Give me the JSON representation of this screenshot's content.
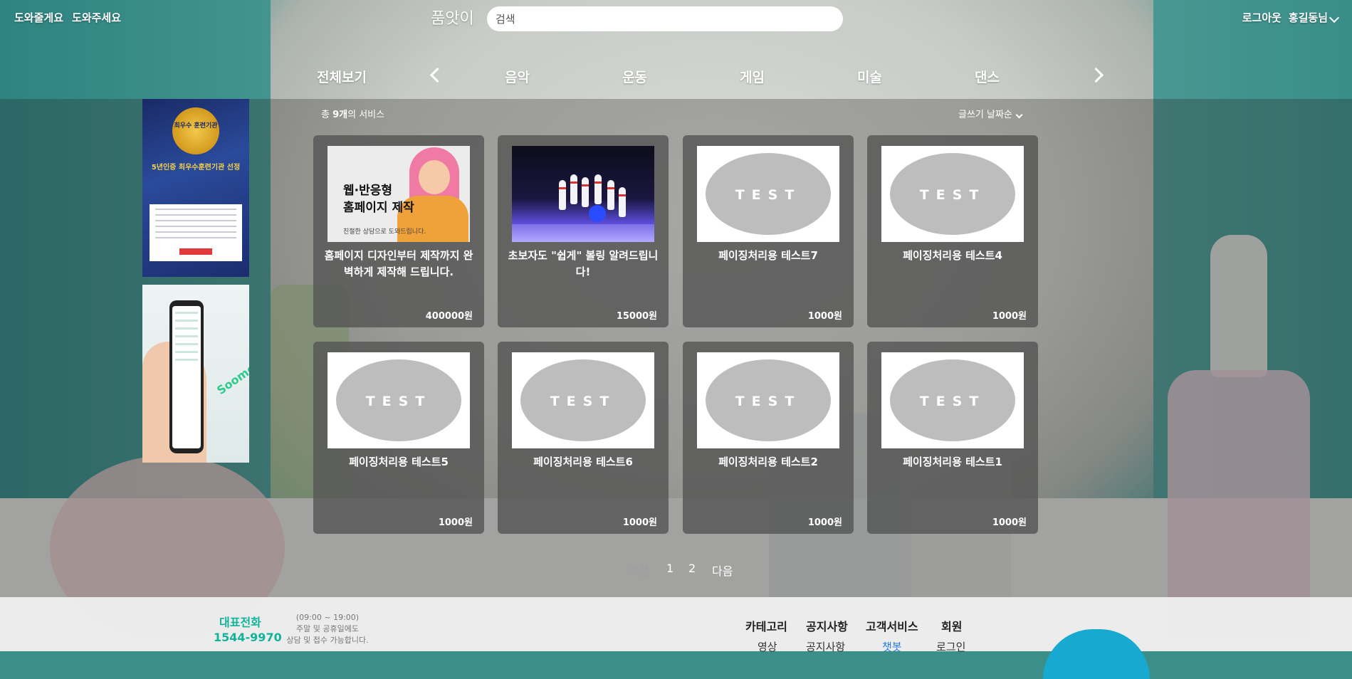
{
  "header": {
    "help_left_1": "도와줄게요",
    "help_left_2": "도와주세요",
    "logo": "품앗이",
    "search_placeholder": "검색",
    "logout": "로그아웃",
    "user_name": "홍길동님"
  },
  "nav": {
    "all": "전체보기",
    "categories": [
      "음악",
      "운동",
      "게임",
      "미술",
      "댄스"
    ]
  },
  "ads": {
    "ad1_badge": "최우수 훈련기관",
    "ad1_headline_1": "5년인증 최우수훈련기관 선정"
  },
  "list": {
    "count_prefix": "총",
    "count": "9개",
    "count_suffix": "의 서비스",
    "sort_label": "글쓰기 날짜순"
  },
  "cards": [
    {
      "title": "홈페이지 디자인부터 제작까지 완벽하게 제작해 드립니다.",
      "price": "400000원",
      "thumb": "web"
    },
    {
      "title": "초보자도 \"쉽게\" 볼링 알려드립니다!",
      "price": "15000원",
      "thumb": "bowling"
    },
    {
      "title": "페이징처리용 테스트7",
      "price": "1000원",
      "thumb": "test"
    },
    {
      "title": "페이징처리용 테스트4",
      "price": "1000원",
      "thumb": "test"
    },
    {
      "title": "페이징처리용 테스트5",
      "price": "1000원",
      "thumb": "test"
    },
    {
      "title": "페이징처리용 테스트6",
      "price": "1000원",
      "thumb": "test"
    },
    {
      "title": "페이징처리용 테스트2",
      "price": "1000원",
      "thumb": "test"
    },
    {
      "title": "페이징처리용 테스트1",
      "price": "1000원",
      "thumb": "test"
    }
  ],
  "thumb_text": {
    "test": "TEST",
    "web_line1": "웹·반응형",
    "web_line2": "홈페이지 제작",
    "web_line3": "친절한 상담으로 도와드립니다."
  },
  "pagination": {
    "prev": "이전",
    "pages": [
      "1",
      "2"
    ],
    "next": "다음"
  },
  "footer": {
    "tel_label": "대표전화",
    "tel": "1544-9970",
    "hours_1": "(09:00 ~ 19:00)",
    "hours_2": "주말 및 공휴일에도",
    "hours_3": "상담 및 접수 가능합니다.",
    "menu": [
      "카테고리",
      "공지사항",
      "고객서비스",
      "회원"
    ],
    "sub": [
      "영상",
      "공지사항",
      "챗봇",
      "로그인"
    ]
  },
  "colors": {
    "accent": "#12b39a",
    "link_active": "#2a7be0"
  }
}
